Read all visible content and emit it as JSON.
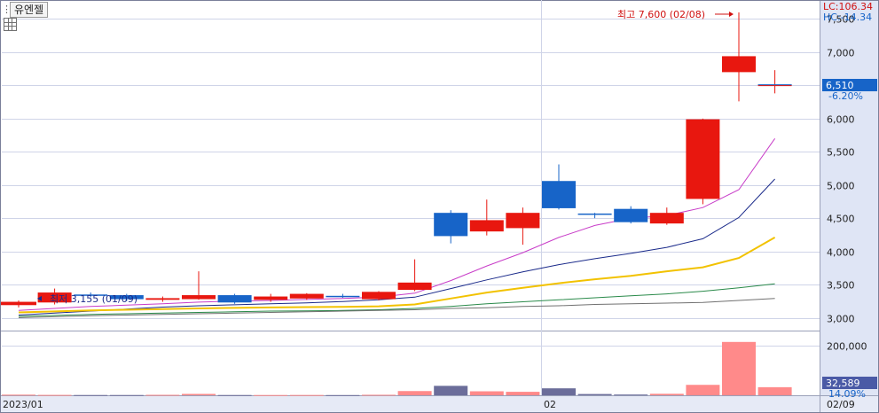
{
  "header": {
    "title": "유엔젤"
  },
  "colors": {
    "up": "#e8170f",
    "down": "#1764c8",
    "volume": "#ff8a8a",
    "volume_down": "#6b6d9a",
    "grid": "#cfd4e8",
    "axis_bg": "#dfe5f5"
  },
  "indicators": {
    "lc": "LC:106.34",
    "hc": "HC:-14.34"
  },
  "price_badge": {
    "price": "6,510",
    "change": "-6.20%"
  },
  "volume_badge": {
    "volume": "32,589",
    "ratio": "14.09%"
  },
  "annotations": {
    "high": "최고 7,600 (02/08)",
    "low": "최저 3,155 (01/09)"
  },
  "chart_data": {
    "type": "candlestick",
    "x_labels": [
      "2023/01",
      "02",
      "02/09"
    ],
    "y_ticks": [
      "3,000",
      "3,500",
      "4,000",
      "4,500",
      "5,000",
      "5,500",
      "6,000",
      "6,500",
      "7,000",
      "7,500"
    ],
    "y_values": [
      3000,
      3500,
      4000,
      4500,
      5000,
      5500,
      6000,
      6500,
      7000,
      7500
    ],
    "ylim": [
      2820,
      7760
    ],
    "volume_ticks": [
      "200,000"
    ],
    "volume_tick_values": [
      200000
    ],
    "volume_ylim": [
      0,
      250000
    ],
    "candles": [
      {
        "o": 3190,
        "h": 3260,
        "l": 3155,
        "c": 3240
      },
      {
        "o": 3230,
        "h": 3440,
        "l": 3200,
        "c": 3380
      },
      {
        "o": 3350,
        "h": 3380,
        "l": 3310,
        "c": 3330
      },
      {
        "o": 3340,
        "h": 3360,
        "l": 3250,
        "c": 3280
      },
      {
        "o": 3270,
        "h": 3320,
        "l": 3240,
        "c": 3295
      },
      {
        "o": 3280,
        "h": 3700,
        "l": 3270,
        "c": 3340
      },
      {
        "o": 3340,
        "h": 3360,
        "l": 3210,
        "c": 3230
      },
      {
        "o": 3270,
        "h": 3360,
        "l": 3240,
        "c": 3320
      },
      {
        "o": 3290,
        "h": 3370,
        "l": 3270,
        "c": 3360
      },
      {
        "o": 3330,
        "h": 3360,
        "l": 3300,
        "c": 3320
      },
      {
        "o": 3280,
        "h": 3400,
        "l": 3260,
        "c": 3390
      },
      {
        "o": 3420,
        "h": 3880,
        "l": 3400,
        "c": 3530
      },
      {
        "o": 4580,
        "h": 4620,
        "l": 4120,
        "c": 4230
      },
      {
        "o": 4300,
        "h": 4780,
        "l": 4240,
        "c": 4470
      },
      {
        "o": 4350,
        "h": 4660,
        "l": 4100,
        "c": 4580
      },
      {
        "o": 5060,
        "h": 5310,
        "l": 4630,
        "c": 4650
      },
      {
        "o": 4570,
        "h": 4580,
        "l": 4500,
        "c": 4550
      },
      {
        "o": 4640,
        "h": 4680,
        "l": 4420,
        "c": 4440
      },
      {
        "o": 4420,
        "h": 4660,
        "l": 4400,
        "c": 4580
      },
      {
        "o": 4790,
        "h": 6000,
        "l": 4710,
        "c": 5990
      },
      {
        "o": 6700,
        "h": 7600,
        "l": 6260,
        "c": 6940
      },
      {
        "o": 6510,
        "h": 6730,
        "l": 6380,
        "c": 6510
      }
    ],
    "series": [
      {
        "values": [
          3110,
          3140,
          3170,
          3190,
          3210,
          3235,
          3250,
          3260,
          3275,
          3290,
          3310,
          3370,
          3560,
          3780,
          3980,
          4210,
          4390,
          4500,
          4540,
          4660,
          4930,
          5700
        ]
      },
      {
        "values": [
          3040,
          3070,
          3100,
          3130,
          3160,
          3180,
          3195,
          3210,
          3225,
          3245,
          3270,
          3310,
          3440,
          3570,
          3690,
          3800,
          3890,
          3970,
          4060,
          4190,
          4510,
          5090
        ]
      },
      {
        "values": [
          3080,
          3095,
          3110,
          3120,
          3130,
          3140,
          3148,
          3155,
          3160,
          3165,
          3172,
          3200,
          3290,
          3380,
          3450,
          3520,
          3580,
          3630,
          3700,
          3760,
          3900,
          4210
        ]
      },
      {
        "values": [
          3020,
          3035,
          3050,
          3060,
          3070,
          3080,
          3090,
          3100,
          3105,
          3110,
          3120,
          3140,
          3170,
          3210,
          3240,
          3270,
          3300,
          3330,
          3360,
          3400,
          3450,
          3510
        ]
      },
      {
        "values": [
          3000,
          3015,
          3030,
          3040,
          3050,
          3060,
          3070,
          3080,
          3090,
          3100,
          3110,
          3120,
          3140,
          3150,
          3170,
          3180,
          3200,
          3210,
          3220,
          3230,
          3260,
          3290
        ]
      }
    ],
    "volume": [
      2500,
      1500,
      1000,
      1000,
      1800,
      5500,
      1000,
      1000,
      1200,
      800,
      2000,
      17000,
      38000,
      16000,
      14000,
      28000,
      5000,
      3000,
      6000,
      42000,
      215000,
      32589
    ]
  }
}
